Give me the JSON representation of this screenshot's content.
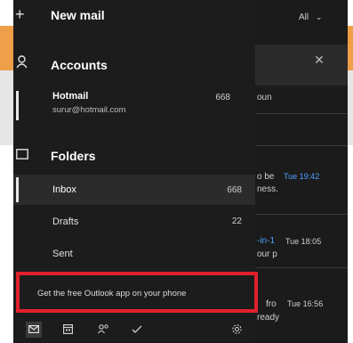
{
  "header": {
    "new_mail_label": "New mail",
    "filter_label": "All"
  },
  "accounts": {
    "header_label": "Accounts",
    "items": [
      {
        "name": "Hotmail",
        "email": "surur@hotmail.com",
        "count": "668"
      }
    ]
  },
  "folders": {
    "header_label": "Folders",
    "items": [
      {
        "label": "Inbox",
        "count": "668"
      },
      {
        "label": "Drafts",
        "count": "22"
      },
      {
        "label": "Sent",
        "count": ""
      }
    ]
  },
  "promo": {
    "text": "Get the free Outlook app on your phone"
  },
  "message_list": {
    "fragments": [
      {
        "text": "oun"
      },
      {
        "text": "o be",
        "time": "Tue 19:42",
        "line2": "ness."
      },
      {
        "text": "-in-1",
        "time": "Tue 18:05",
        "line2": "our p"
      },
      {
        "text": "fro",
        "time": "Tue 16:56",
        "line2": "ready"
      }
    ]
  },
  "icons": {
    "new_mail": "plus-icon",
    "accounts": "person-icon",
    "folders": "folder-icon",
    "chevron": "chevron-down-icon",
    "close": "close-icon",
    "mail": "mail-icon",
    "calendar": "calendar-icon",
    "people": "people-icon",
    "todo": "todo-icon",
    "settings": "gear-icon"
  },
  "colors": {
    "accent_orange": "#ef9f48",
    "promo_border": "#e0212b",
    "pane_bg": "#1c1c1c",
    "link_blue": "#4ea3ff"
  }
}
